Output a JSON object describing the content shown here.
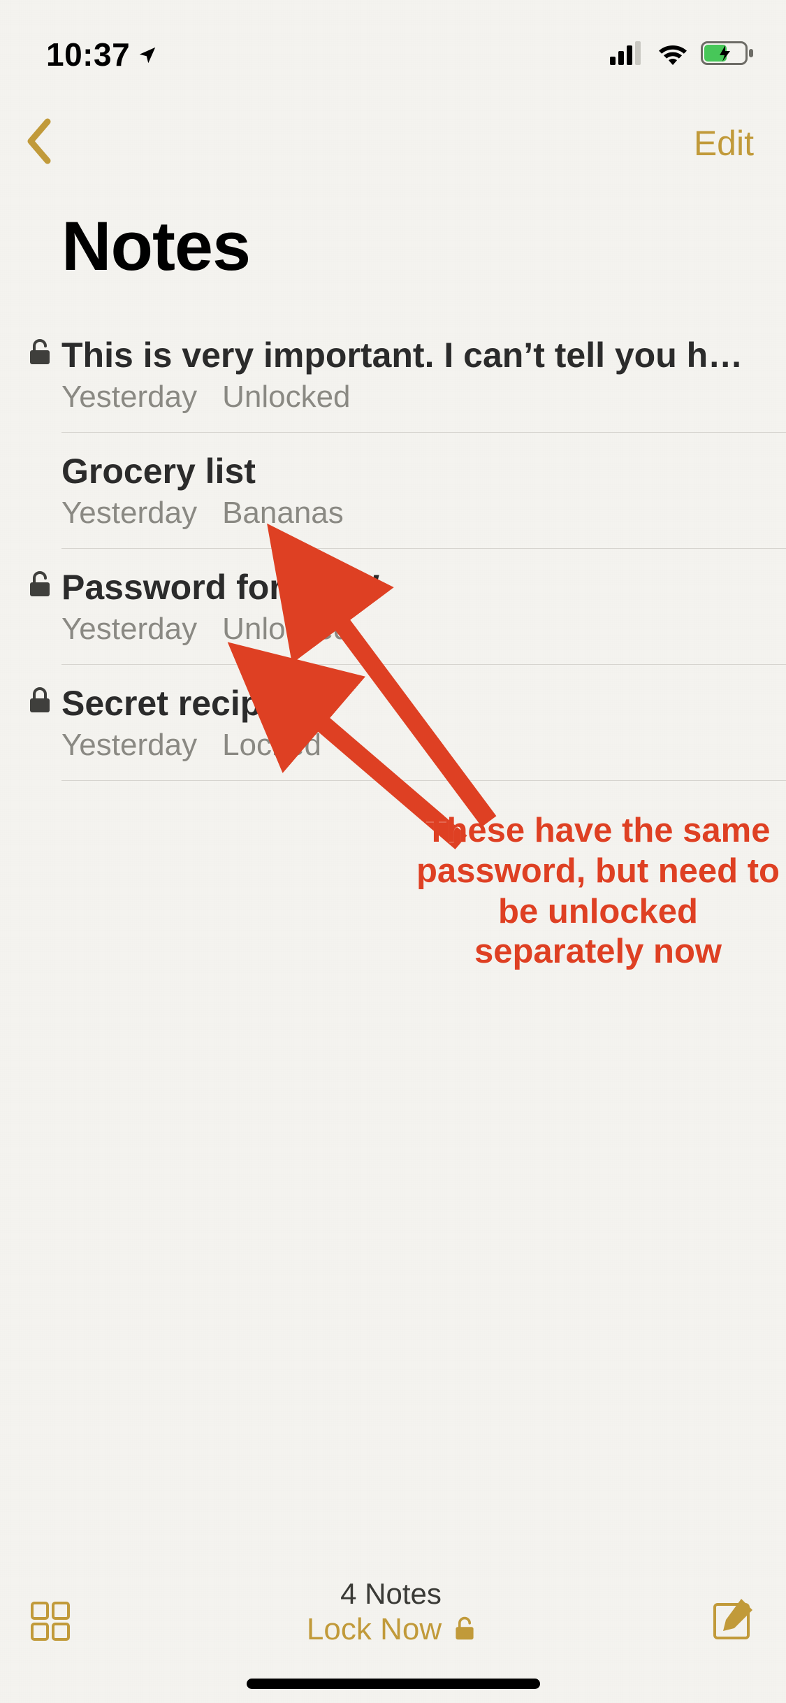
{
  "status": {
    "time": "10:37",
    "location_icon": "location-arrow-icon"
  },
  "nav": {
    "back_icon": "chevron-left-icon",
    "edit_label": "Edit"
  },
  "title": "Notes",
  "notes": [
    {
      "lock_state": "unlocked",
      "show_lock": true,
      "title": "This is very important. I can’t tell you how se…",
      "date": "Yesterday",
      "preview": "Unlocked"
    },
    {
      "lock_state": "none",
      "show_lock": false,
      "title": "Grocery list",
      "date": "Yesterday",
      "preview": "Bananas"
    },
    {
      "lock_state": "unlocked",
      "show_lock": true,
      "title": "Password for WoW",
      "date": "Yesterday",
      "preview": "Unlocked"
    },
    {
      "lock_state": "locked",
      "show_lock": true,
      "title": "Secret recipe",
      "date": "Yesterday",
      "preview": "Locked"
    }
  ],
  "toolbar": {
    "count_label": "4 Notes",
    "lock_now_label": "Lock Now"
  },
  "annotation": {
    "text": "These have the same password, but need to be unlocked separately now"
  },
  "colors": {
    "accent": "#c19a3a",
    "annotation": "#de4023"
  }
}
